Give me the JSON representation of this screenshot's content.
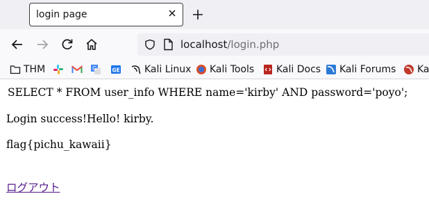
{
  "tab": {
    "title": "login page"
  },
  "urlbar": {
    "host": "localhost",
    "path": "/login.php"
  },
  "bookmarks": [
    {
      "label": "THM",
      "icon": "folder-icon"
    },
    {
      "label": "",
      "icon": "slack-icon"
    },
    {
      "label": "",
      "icon": "gmail-icon"
    },
    {
      "label": "",
      "icon": "translate-icon"
    },
    {
      "label": "",
      "icon": "google-sheets-icon"
    },
    {
      "label": "Kali Linux",
      "icon": "kali-dragon-icon"
    },
    {
      "label": "Kali Tools",
      "icon": "kali-tools-icon"
    },
    {
      "label": "Kali Docs",
      "icon": "kali-docs-icon"
    },
    {
      "label": "Kali Forums",
      "icon": "kali-forums-icon"
    },
    {
      "label": "Kal",
      "icon": "kali-nethunter-icon"
    }
  ],
  "page": {
    "sql": "SELECT * FROM user_info WHERE name='kirby' AND password='poyo';",
    "message": "Login success!Hello! kirby.",
    "flag": "flag{pichu_kawaii}",
    "logout_link": "ログアウト"
  }
}
